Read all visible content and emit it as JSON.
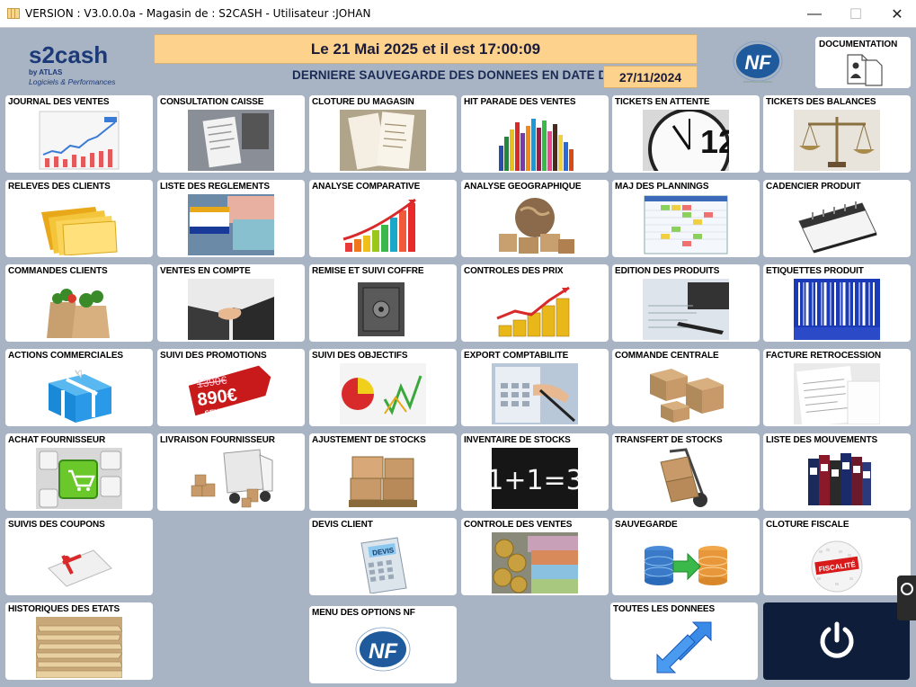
{
  "window": {
    "title": "VERSION  : V3.0.0.0a - Magasin de : S2CASH - Utilisateur :JOHAN",
    "minimize_glyph": "—",
    "maximize_glyph": "☐",
    "close_glyph": "✕"
  },
  "logo": {
    "brand": "s2cash",
    "sub1": "by ATLAS",
    "sub2": "Logiciels & Performances"
  },
  "header": {
    "datetime": "Le 21 Mai 2025 et il est 17:00:09",
    "backup_label": "DERNIERE SAUVEGARDE DES DONNEES EN DATE DU",
    "backup_date": "27/11/2024",
    "documentation": "DOCUMENTATION"
  },
  "tiles": {
    "journal_ventes": "JOURNAL DES VENTES",
    "consultation_caisse": "CONSULTATION CAISSE",
    "cloture_magasin": "CLOTURE DU MAGASIN",
    "hit_parade": "HIT PARADE DES VENTES",
    "tickets_attente": "TICKETS EN ATTENTE",
    "tickets_balances": "TICKETS DES BALANCES",
    "releves_clients": "RELEVES DES CLIENTS",
    "liste_reglements": "LISTE DES REGLEMENTS",
    "analyse_comparative": "ANALYSE COMPARATIVE",
    "analyse_geographique": "ANALYSE GEOGRAPHIQUE",
    "maj_plannings": "MAJ DES PLANNINGS",
    "cadencier_produit": "CADENCIER PRODUIT",
    "commandes_clients": "COMMANDES CLIENTS",
    "ventes_compte": "VENTES EN COMPTE",
    "remise_coffre": "REMISE ET SUIVI COFFRE",
    "controles_prix": "CONTROLES DES PRIX",
    "edition_produits": "EDITION DES PRODUITS",
    "etiquettes_produit": "ETIQUETTES PRODUIT",
    "actions_commerciales": "ACTIONS COMMERCIALES",
    "suivi_promotions": "SUIVI DES PROMOTIONS",
    "suivi_objectifs": "SUIVI DES OBJECTIFS",
    "export_comptabilite": "EXPORT COMPTABILITE",
    "commande_centrale": "COMMANDE CENTRALE",
    "facture_retrocession": "FACTURE RETROCESSION",
    "achat_fournisseur": "ACHAT FOURNISSEUR",
    "livraison_fournisseur": "LIVRAISON FOURNISSEUR",
    "ajustement_stocks": "AJUSTEMENT DE STOCKS",
    "inventaire_stocks": "INVENTAIRE DE STOCKS",
    "transfert_stocks": "TRANSFERT DE STOCKS",
    "liste_mouvements": "LISTE DES MOUVEMENTS",
    "suivis_coupons": "SUIVIS DES COUPONS",
    "devis_client": "DEVIS CLIENT",
    "controle_ventes": "CONTROLE DES VENTES",
    "sauvegarde": "SAUVEGARDE",
    "cloture_fiscale": "CLOTURE FISCALE",
    "historiques_etats": "HISTORIQUES DES ETATS",
    "menu_options_nf": "MENU DES OPTIONS NF",
    "toutes_donnees": "TOUTES LES DONNEES"
  },
  "images": {
    "promo_old_price": "1390€",
    "promo_new_price": "890€",
    "promo_seulement": "SEULEMENT",
    "devis_screen": "DEVIS",
    "fiscalite": "FISCALITÉ",
    "inventaire_formula": "1+1=3",
    "clock_12": "12",
    "nf_mark": "NF"
  },
  "colors": {
    "background": "#a8b4c4",
    "header_bar": "#fcd28c",
    "power_tile": "#0e1e3a",
    "nf_blue": "#1e5a9c"
  }
}
